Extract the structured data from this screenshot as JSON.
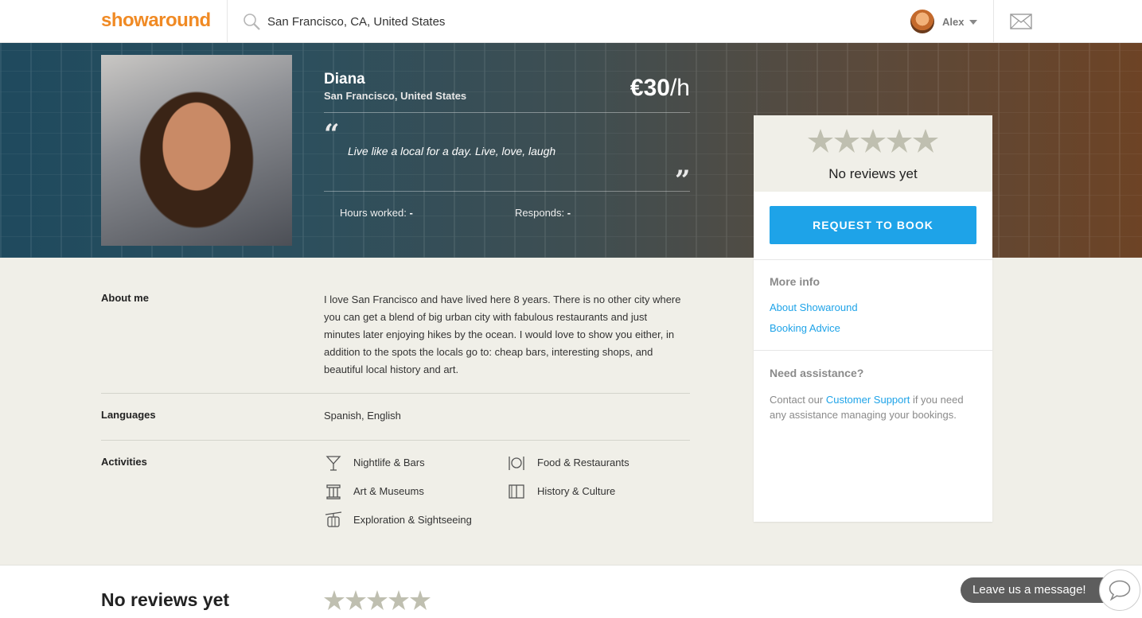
{
  "header": {
    "logo": "showaround",
    "search_value": "San Francisco, CA, United States",
    "user_name": "Alex"
  },
  "profile": {
    "name": "Diana",
    "location": "San Francisco, United States",
    "price_amount": "€30",
    "price_unit": "/h",
    "tagline": "Live like a local for a day. Live, love, laugh",
    "hours_label": "Hours worked:",
    "hours_value": "-",
    "responds_label": "Responds:",
    "responds_value": "-"
  },
  "card": {
    "rating_stars": 0,
    "no_reviews": "No reviews yet",
    "book_label": "REQUEST TO BOOK",
    "more_info_heading": "More info",
    "link_about": "About Showaround",
    "link_booking": "Booking Advice",
    "assist_heading": "Need assistance?",
    "assist_prefix": "Contact our ",
    "assist_link": "Customer Support",
    "assist_suffix": " if you need any assistance managing your bookings."
  },
  "sections": {
    "about_label": "About me",
    "about_text": "I love San Francisco and have lived here 8 years. There is no other city where you can get a blend of big urban city with fabulous restaurants and just minutes later enjoying hikes by the ocean. I would love to show you either, in addition to the spots the locals go to: cheap bars, interesting shops, and beautiful local history and art.",
    "languages_label": "Languages",
    "languages_value": "Spanish, English",
    "activities_label": "Activities",
    "activities": [
      {
        "label": "Nightlife & Bars",
        "icon": "cocktail-icon"
      },
      {
        "label": "Food & Restaurants",
        "icon": "plate-cutlery-icon"
      },
      {
        "label": "Art & Museums",
        "icon": "museum-icon"
      },
      {
        "label": "History & Culture",
        "icon": "book-icon"
      },
      {
        "label": "Exploration & Sightseeing",
        "icon": "cable-car-icon"
      }
    ]
  },
  "bottom": {
    "title": "No reviews yet",
    "rating_stars": 0
  },
  "chat": {
    "label": "Leave us a message!"
  },
  "colors": {
    "brand": "#f08a24",
    "accent": "#1ea3e8",
    "star": "#bfbfb0"
  }
}
